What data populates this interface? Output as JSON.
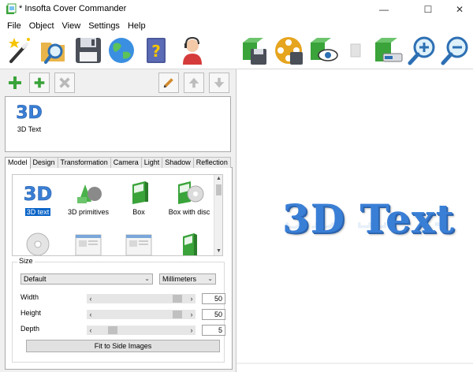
{
  "window": {
    "title": "* Insofta Cover Commander",
    "min_glyph": "—",
    "max_glyph": "☐",
    "close_glyph": "✕"
  },
  "menu": [
    "File",
    "Object",
    "View",
    "Settings",
    "Help"
  ],
  "toolbar": {
    "icons": [
      "magic-wand-icon",
      "open-folder-icon",
      "save-disk-icon",
      "globe-icon",
      "help-book-icon",
      "support-agent-icon",
      "save-image-icon",
      "render-video-icon",
      "preview-eye-icon",
      "blank-icon",
      "export-image-icon",
      "zoom-in-icon",
      "zoom-out-icon"
    ]
  },
  "project_toolbar": {
    "icons": [
      "add-icon",
      "add-small-icon",
      "delete-icon",
      "rename-icon",
      "move-up-icon",
      "move-down-icon"
    ]
  },
  "project_list": {
    "items": [
      {
        "label": "3D Text",
        "icon": "3d-text-icon"
      }
    ]
  },
  "tabs": [
    "Model",
    "Design",
    "Transformation",
    "Camera",
    "Light",
    "Shadow",
    "Reflection"
  ],
  "active_tab": "Model",
  "gallery": {
    "items": [
      {
        "label": "3D text",
        "icon": "3d-text-icon",
        "selected": true
      },
      {
        "label": "3D primitives",
        "icon": "primitives-icon",
        "selected": false
      },
      {
        "label": "Box",
        "icon": "box-icon",
        "selected": false
      },
      {
        "label": "Box with disc",
        "icon": "box-with-disc-icon",
        "selected": false
      },
      {
        "label": "",
        "icon": "cd-disc-icon",
        "selected": false
      },
      {
        "label": "",
        "icon": "screenshot-icon",
        "selected": false
      },
      {
        "label": "",
        "icon": "screenshot-icon",
        "selected": false
      },
      {
        "label": "",
        "icon": "book-icon",
        "selected": false
      }
    ]
  },
  "size": {
    "title": "Size",
    "preset": "Default",
    "unit": "Millimeters",
    "rows": [
      {
        "label": "Width",
        "value": "50",
        "position": 0.93
      },
      {
        "label": "Height",
        "value": "50",
        "position": 0.93
      },
      {
        "label": "Depth",
        "value": "5",
        "position": 0.16
      }
    ],
    "fit_button": "Fit to Side Images"
  },
  "preview": {
    "text": "3D Text"
  },
  "colors": {
    "accent_green": "#3aa33a",
    "text_blue": "#3a7fd6",
    "selection": "#0a64c8"
  }
}
